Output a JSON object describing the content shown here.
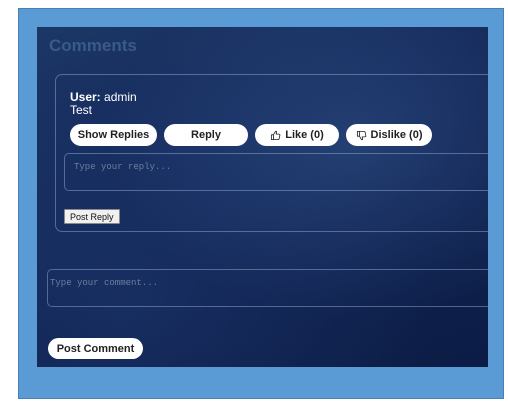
{
  "page": {
    "title": "Comments"
  },
  "comment": {
    "user_label": "User:",
    "user_name": "admin",
    "text": "Test",
    "actions": {
      "show_replies": "Show Replies",
      "reply": "Reply",
      "like": "Like (0)",
      "dislike": "Dislike (0)"
    },
    "reply_placeholder": "Type your reply...",
    "post_reply_label": "Post Reply"
  },
  "new_comment": {
    "placeholder": "Type your comment...",
    "post_label": "Post Comment"
  },
  "colors": {
    "frame": "#5b9bd5",
    "panel": "#14295a",
    "title": "#3a5a8c",
    "button_bg": "#ffffff"
  },
  "icons": {
    "like": "thumbs-up-icon",
    "dislike": "thumbs-down-icon"
  }
}
